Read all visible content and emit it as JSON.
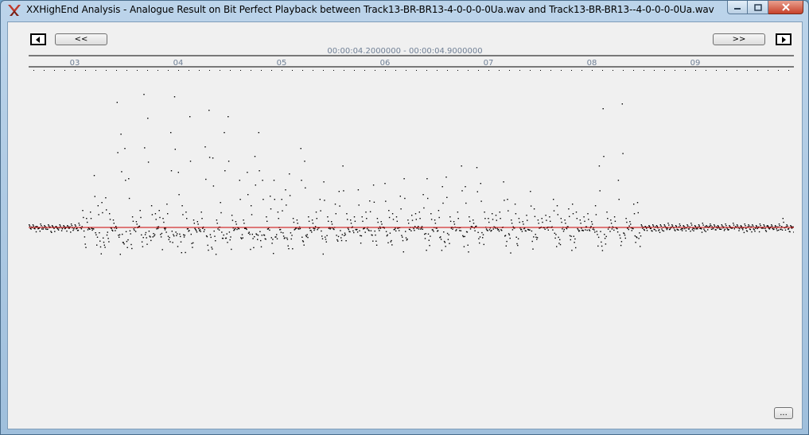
{
  "window": {
    "title": "XXHighEnd Analysis - Analogue Result on Bit Perfect Playback between Track13-BR-BR13-4-0-0-0-0Ua.wav and Track13-BR-BR13--4-0-0-0-0Ua.wav",
    "icon": "xxhighend-logo-icon",
    "controls": [
      "minimize-icon",
      "maximize-icon",
      "close-icon"
    ]
  },
  "nav": {
    "prev_label": "<<",
    "next_label": ">>",
    "step_back_icon": "triangle-left-icon",
    "step_forward_icon": "triangle-right-icon"
  },
  "time_range": "00:00:04.2000000 - 00:00:04.9000000",
  "more_button": "...",
  "chart_data": {
    "type": "scatter",
    "x_tick_labels": [
      "03",
      "04",
      "05",
      "06",
      "07",
      "08",
      "09"
    ],
    "baseline_color": "#cc0000",
    "point_color": "#000000",
    "grid": false,
    "points_description_note": "",
    "segments": [
      {
        "x": 0.0,
        "peak": 4
      },
      {
        "x": 0.005,
        "peak": 4
      },
      {
        "x": 0.01,
        "peak": 2
      },
      {
        "x": 0.015,
        "peak": 5
      },
      {
        "x": 0.02,
        "peak": 3
      },
      {
        "x": 0.025,
        "peak": 4
      },
      {
        "x": 0.03,
        "peak": 3
      },
      {
        "x": 0.035,
        "peak": 2
      },
      {
        "x": 0.04,
        "peak": 4
      },
      {
        "x": 0.045,
        "peak": 3
      },
      {
        "x": 0.05,
        "peak": 3
      },
      {
        "x": 0.055,
        "peak": 5
      },
      {
        "x": 0.06,
        "peak": 4
      },
      {
        "x": 0.065,
        "peak": 6
      },
      {
        "x": 0.07,
        "peak": 22
      },
      {
        "x": 0.075,
        "peak": 12
      },
      {
        "x": 0.08,
        "peak": 20
      },
      {
        "x": 0.085,
        "peak": 66
      },
      {
        "x": 0.09,
        "peak": 28
      },
      {
        "x": 0.095,
        "peak": 32
      },
      {
        "x": 0.1,
        "peak": 38
      },
      {
        "x": 0.105,
        "peak": 18
      },
      {
        "x": 0.11,
        "peak": 10
      },
      {
        "x": 0.115,
        "peak": 158
      },
      {
        "x": 0.12,
        "peak": 118
      },
      {
        "x": 0.125,
        "peak": 100
      },
      {
        "x": 0.13,
        "peak": 62
      },
      {
        "x": 0.135,
        "peak": 14
      },
      {
        "x": 0.14,
        "peak": 8
      },
      {
        "x": 0.145,
        "peak": 22
      },
      {
        "x": 0.15,
        "peak": 168
      },
      {
        "x": 0.155,
        "peak": 138
      },
      {
        "x": 0.16,
        "peak": 28
      },
      {
        "x": 0.165,
        "peak": 18
      },
      {
        "x": 0.17,
        "peak": 22
      },
      {
        "x": 0.175,
        "peak": 12
      },
      {
        "x": 0.18,
        "peak": 30
      },
      {
        "x": 0.185,
        "peak": 120
      },
      {
        "x": 0.19,
        "peak": 165
      },
      {
        "x": 0.195,
        "peak": 70
      },
      {
        "x": 0.2,
        "peak": 28
      },
      {
        "x": 0.205,
        "peak": 20
      },
      {
        "x": 0.21,
        "peak": 140
      },
      {
        "x": 0.215,
        "peak": 10
      },
      {
        "x": 0.22,
        "peak": 8
      },
      {
        "x": 0.225,
        "peak": 20
      },
      {
        "x": 0.23,
        "peak": 102
      },
      {
        "x": 0.235,
        "peak": 148
      },
      {
        "x": 0.24,
        "peak": 88
      },
      {
        "x": 0.245,
        "peak": 10
      },
      {
        "x": 0.25,
        "peak": 32
      },
      {
        "x": 0.255,
        "peak": 120
      },
      {
        "x": 0.26,
        "peak": 140
      },
      {
        "x": 0.265,
        "peak": 16
      },
      {
        "x": 0.27,
        "peak": 8
      },
      {
        "x": 0.275,
        "peak": 60
      },
      {
        "x": 0.28,
        "peak": 10
      },
      {
        "x": 0.285,
        "peak": 70
      },
      {
        "x": 0.29,
        "peak": 28
      },
      {
        "x": 0.295,
        "peak": 90
      },
      {
        "x": 0.3,
        "peak": 120
      },
      {
        "x": 0.305,
        "peak": 60
      },
      {
        "x": 0.31,
        "peak": 14
      },
      {
        "x": 0.315,
        "peak": 40
      },
      {
        "x": 0.32,
        "peak": 60
      },
      {
        "x": 0.325,
        "peak": 20
      },
      {
        "x": 0.33,
        "peak": 36
      },
      {
        "x": 0.335,
        "peak": 48
      },
      {
        "x": 0.34,
        "peak": 68
      },
      {
        "x": 0.345,
        "peak": 12
      },
      {
        "x": 0.35,
        "peak": 10
      },
      {
        "x": 0.355,
        "peak": 100
      },
      {
        "x": 0.36,
        "peak": 84
      },
      {
        "x": 0.365,
        "peak": 14
      },
      {
        "x": 0.37,
        "peak": 10
      },
      {
        "x": 0.375,
        "peak": 20
      },
      {
        "x": 0.38,
        "peak": 36
      },
      {
        "x": 0.385,
        "peak": 58
      },
      {
        "x": 0.39,
        "peak": 14
      },
      {
        "x": 0.395,
        "peak": 8
      },
      {
        "x": 0.4,
        "peak": 30
      },
      {
        "x": 0.405,
        "peak": 46
      },
      {
        "x": 0.41,
        "peak": 78
      },
      {
        "x": 0.415,
        "peak": 18
      },
      {
        "x": 0.42,
        "peak": 10
      },
      {
        "x": 0.425,
        "peak": 14
      },
      {
        "x": 0.43,
        "peak": 48
      },
      {
        "x": 0.435,
        "peak": 14
      },
      {
        "x": 0.44,
        "peak": 20
      },
      {
        "x": 0.445,
        "peak": 34
      },
      {
        "x": 0.45,
        "peak": 54
      },
      {
        "x": 0.455,
        "peak": 12
      },
      {
        "x": 0.46,
        "peak": 8
      },
      {
        "x": 0.465,
        "peak": 56
      },
      {
        "x": 0.47,
        "peak": 22
      },
      {
        "x": 0.475,
        "peak": 18
      },
      {
        "x": 0.48,
        "peak": 14
      },
      {
        "x": 0.485,
        "peak": 40
      },
      {
        "x": 0.49,
        "peak": 62
      },
      {
        "x": 0.495,
        "peak": 10
      },
      {
        "x": 0.5,
        "peak": 16
      },
      {
        "x": 0.505,
        "peak": 18
      },
      {
        "x": 0.51,
        "peak": 20
      },
      {
        "x": 0.515,
        "peak": 42
      },
      {
        "x": 0.52,
        "peak": 62
      },
      {
        "x": 0.525,
        "peak": 18
      },
      {
        "x": 0.53,
        "peak": 10
      },
      {
        "x": 0.535,
        "peak": 22
      },
      {
        "x": 0.54,
        "peak": 52
      },
      {
        "x": 0.545,
        "peak": 64
      },
      {
        "x": 0.55,
        "peak": 14
      },
      {
        "x": 0.555,
        "peak": 8
      },
      {
        "x": 0.56,
        "peak": 20
      },
      {
        "x": 0.565,
        "peak": 78
      },
      {
        "x": 0.57,
        "peak": 52
      },
      {
        "x": 0.575,
        "peak": 14
      },
      {
        "x": 0.58,
        "peak": 10
      },
      {
        "x": 0.585,
        "peak": 76
      },
      {
        "x": 0.59,
        "peak": 56
      },
      {
        "x": 0.595,
        "peak": 20
      },
      {
        "x": 0.6,
        "peak": 12
      },
      {
        "x": 0.605,
        "peak": 18
      },
      {
        "x": 0.61,
        "peak": 16
      },
      {
        "x": 0.615,
        "peak": 20
      },
      {
        "x": 0.62,
        "peak": 58
      },
      {
        "x": 0.625,
        "peak": 36
      },
      {
        "x": 0.63,
        "peak": 10
      },
      {
        "x": 0.635,
        "peak": 30
      },
      {
        "x": 0.64,
        "peak": 12
      },
      {
        "x": 0.645,
        "peak": 8
      },
      {
        "x": 0.65,
        "peak": 16
      },
      {
        "x": 0.655,
        "peak": 46
      },
      {
        "x": 0.66,
        "peak": 24
      },
      {
        "x": 0.665,
        "peak": 10
      },
      {
        "x": 0.67,
        "peak": 12
      },
      {
        "x": 0.675,
        "peak": 16
      },
      {
        "x": 0.68,
        "peak": 14
      },
      {
        "x": 0.685,
        "peak": 36
      },
      {
        "x": 0.69,
        "peak": 28
      },
      {
        "x": 0.695,
        "peak": 12
      },
      {
        "x": 0.7,
        "peak": 10
      },
      {
        "x": 0.705,
        "peak": 24
      },
      {
        "x": 0.71,
        "peak": 30
      },
      {
        "x": 0.715,
        "peak": 20
      },
      {
        "x": 0.72,
        "peak": 10
      },
      {
        "x": 0.725,
        "peak": 14
      },
      {
        "x": 0.73,
        "peak": 18
      },
      {
        "x": 0.735,
        "peak": 8
      },
      {
        "x": 0.74,
        "peak": 28
      },
      {
        "x": 0.745,
        "peak": 78
      },
      {
        "x": 0.75,
        "peak": 150
      },
      {
        "x": 0.755,
        "peak": 20
      },
      {
        "x": 0.76,
        "peak": 10
      },
      {
        "x": 0.765,
        "peak": 14
      },
      {
        "x": 0.77,
        "peak": 60
      },
      {
        "x": 0.775,
        "peak": 156
      },
      {
        "x": 0.78,
        "peak": 12
      },
      {
        "x": 0.785,
        "peak": 8
      },
      {
        "x": 0.79,
        "peak": 30
      },
      {
        "x": 0.795,
        "peak": 32
      },
      {
        "x": 0.8,
        "peak": 4
      },
      {
        "x": 0.805,
        "peak": 2
      },
      {
        "x": 0.81,
        "peak": 3
      },
      {
        "x": 0.815,
        "peak": 4
      },
      {
        "x": 0.82,
        "peak": 3
      },
      {
        "x": 0.825,
        "peak": 4
      },
      {
        "x": 0.83,
        "peak": 4
      },
      {
        "x": 0.835,
        "peak": 6
      },
      {
        "x": 0.84,
        "peak": 4
      },
      {
        "x": 0.845,
        "peak": 3
      },
      {
        "x": 0.85,
        "peak": 5
      },
      {
        "x": 0.855,
        "peak": 3
      },
      {
        "x": 0.86,
        "peak": 4
      },
      {
        "x": 0.865,
        "peak": 6
      },
      {
        "x": 0.87,
        "peak": 3
      },
      {
        "x": 0.875,
        "peak": 4
      },
      {
        "x": 0.88,
        "peak": 6
      },
      {
        "x": 0.885,
        "peak": 3
      },
      {
        "x": 0.89,
        "peak": 5
      },
      {
        "x": 0.895,
        "peak": 4
      },
      {
        "x": 0.9,
        "peak": 3
      },
      {
        "x": 0.905,
        "peak": 4
      },
      {
        "x": 0.91,
        "peak": 5
      },
      {
        "x": 0.915,
        "peak": 3
      },
      {
        "x": 0.92,
        "peak": 6
      },
      {
        "x": 0.925,
        "peak": 4
      },
      {
        "x": 0.93,
        "peak": 3
      },
      {
        "x": 0.935,
        "peak": 5
      },
      {
        "x": 0.94,
        "peak": 4
      },
      {
        "x": 0.945,
        "peak": 4
      },
      {
        "x": 0.95,
        "peak": 3
      },
      {
        "x": 0.955,
        "peak": 5
      },
      {
        "x": 0.96,
        "peak": 4
      },
      {
        "x": 0.965,
        "peak": 3
      },
      {
        "x": 0.97,
        "peak": 4
      },
      {
        "x": 0.975,
        "peak": 3
      },
      {
        "x": 0.98,
        "peak": 5
      },
      {
        "x": 0.985,
        "peak": 12
      },
      {
        "x": 0.99,
        "peak": 4
      },
      {
        "x": 0.995,
        "peak": 3
      }
    ]
  }
}
